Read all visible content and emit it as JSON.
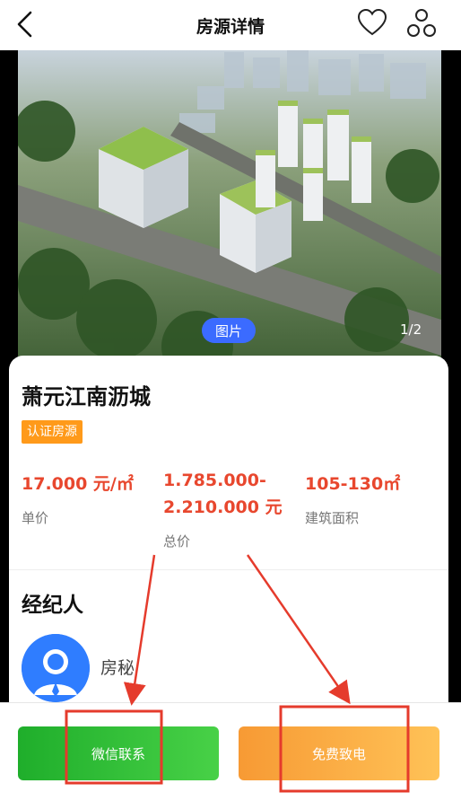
{
  "header": {
    "title": "房源详情"
  },
  "hero": {
    "tag": "图片",
    "counter": "1/2"
  },
  "listing": {
    "name": "萧元江南沥城",
    "badge": "认证房源",
    "unit_price": {
      "value": "17.000 元/㎡",
      "label": "单价"
    },
    "total_price": {
      "value_line1": "1.785.000-",
      "value_line2": "2.210.000 元",
      "label": "总价"
    },
    "area": {
      "value": "105-130㎡",
      "label": "建筑面积"
    }
  },
  "agent": {
    "section_title": "经纪人",
    "name": "房秘"
  },
  "actions": {
    "wechat_label": "微信联系",
    "call_label": "免费致电"
  },
  "colors": {
    "price": "#e8472e",
    "badge": "#ff9a1a",
    "pill": "#3b6bff",
    "wechat": "#2dbd37",
    "call": "#f9a53e",
    "annotation": "#e53b2c"
  },
  "icons": [
    "back-arrow-icon",
    "heart-icon",
    "share-icon",
    "avatar-person-icon"
  ]
}
